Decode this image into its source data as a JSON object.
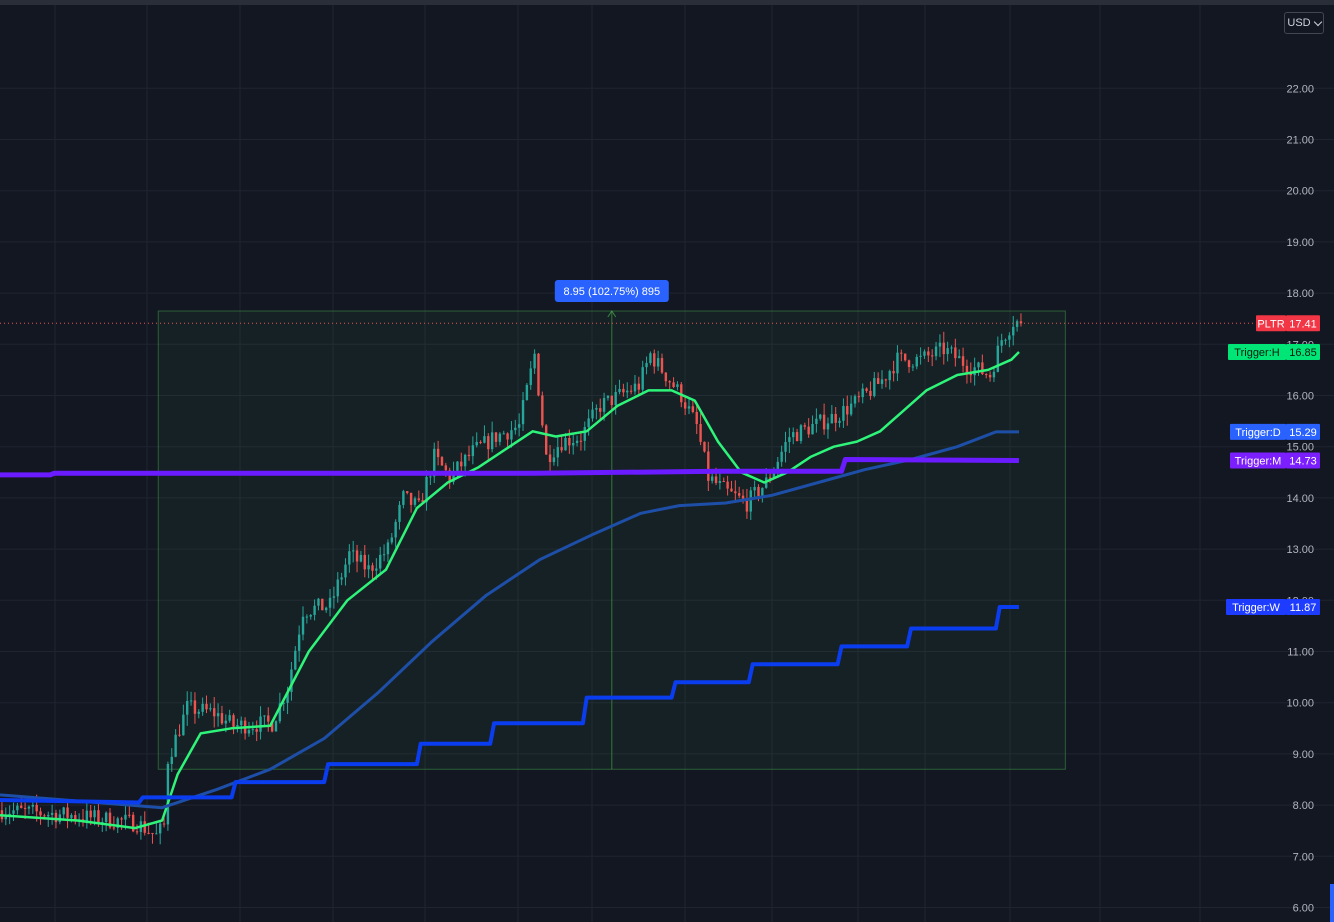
{
  "toolbar": {
    "currency": "USD"
  },
  "colors": {
    "background": "#131722",
    "grid": "#1f2430",
    "axis_text": "#b2b5be",
    "candle_up": "#26a69a",
    "candle_down": "#ef5350",
    "trigger_h": "#2ef57a",
    "trigger_d": "#1e4fa8",
    "trigger_m": "#6a1bff",
    "trigger_w": "#0b3df0",
    "measure_label": "#2962ff"
  },
  "chart_data": {
    "type": "candlestick",
    "symbol": "PLTR",
    "last_price": 17.41,
    "ylim": [
      6.0,
      23.0
    ],
    "y_ticks": [
      "6.00",
      "7.00",
      "8.00",
      "9.00",
      "10.00",
      "11.00",
      "12.00",
      "13.00",
      "14.00",
      "15.00",
      "16.00",
      "17.00",
      "18.00",
      "19.00",
      "20.00",
      "21.00",
      "22.00"
    ],
    "bar_count": 235,
    "price_path": [
      [
        0,
        7.9
      ],
      [
        18,
        7.8
      ],
      [
        35,
        7.65
      ],
      [
        40,
        7.4
      ],
      [
        42,
        7.6
      ],
      [
        43,
        8.9
      ],
      [
        48,
        9.9
      ],
      [
        55,
        9.8
      ],
      [
        60,
        9.55
      ],
      [
        70,
        9.6
      ],
      [
        74,
        10.3
      ],
      [
        78,
        11.8
      ],
      [
        85,
        11.9
      ],
      [
        90,
        12.9
      ],
      [
        95,
        12.6
      ],
      [
        100,
        13.0
      ],
      [
        104,
        14.0
      ],
      [
        108,
        13.8
      ],
      [
        112,
        14.8
      ],
      [
        116,
        14.4
      ],
      [
        122,
        14.9
      ],
      [
        128,
        15.2
      ],
      [
        134,
        15.4
      ],
      [
        138,
        16.8
      ],
      [
        141,
        14.8
      ],
      [
        145,
        15.1
      ],
      [
        150,
        15.2
      ],
      [
        155,
        15.8
      ],
      [
        160,
        16.0
      ],
      [
        165,
        16.2
      ],
      [
        168,
        16.8
      ],
      [
        172,
        16.4
      ],
      [
        176,
        16.0
      ],
      [
        180,
        15.4
      ],
      [
        183,
        14.4
      ],
      [
        188,
        14.1
      ],
      [
        193,
        13.9
      ],
      [
        198,
        14.3
      ],
      [
        204,
        15.2
      ],
      [
        210,
        15.4
      ],
      [
        216,
        15.6
      ],
      [
        222,
        15.9
      ],
      [
        228,
        16.3
      ],
      [
        232,
        16.7
      ],
      [
        238,
        16.7
      ],
      [
        244,
        16.9
      ],
      [
        250,
        16.6
      ],
      [
        256,
        16.4
      ],
      [
        259,
        17.1
      ],
      [
        262,
        17.45
      ],
      [
        264,
        17.41
      ]
    ],
    "measure": {
      "label": "8.95 (102.75%) 895",
      "from": 8.7,
      "to": 17.65,
      "bar_start": 41,
      "bar_end": 276
    },
    "series": [
      {
        "name": "Trigger:H",
        "value": 16.85,
        "label_value": "16.85",
        "points": [
          [
            0,
            7.8
          ],
          [
            20,
            7.7
          ],
          [
            35,
            7.55
          ],
          [
            42,
            7.7
          ],
          [
            46,
            8.6
          ],
          [
            52,
            9.4
          ],
          [
            60,
            9.5
          ],
          [
            70,
            9.55
          ],
          [
            80,
            11.0
          ],
          [
            90,
            12.0
          ],
          [
            100,
            12.6
          ],
          [
            108,
            13.8
          ],
          [
            116,
            14.3
          ],
          [
            124,
            14.6
          ],
          [
            132,
            15.0
          ],
          [
            138,
            15.3
          ],
          [
            144,
            15.2
          ],
          [
            152,
            15.3
          ],
          [
            160,
            15.8
          ],
          [
            168,
            16.1
          ],
          [
            174,
            16.1
          ],
          [
            180,
            15.9
          ],
          [
            186,
            15.1
          ],
          [
            192,
            14.5
          ],
          [
            198,
            14.3
          ],
          [
            204,
            14.5
          ],
          [
            210,
            14.8
          ],
          [
            216,
            15.0
          ],
          [
            222,
            15.1
          ],
          [
            228,
            15.3
          ],
          [
            234,
            15.7
          ],
          [
            240,
            16.1
          ],
          [
            248,
            16.4
          ],
          [
            256,
            16.5
          ],
          [
            262,
            16.7
          ],
          [
            264,
            16.85
          ]
        ]
      },
      {
        "name": "Trigger:D",
        "value": 15.29,
        "label_value": "15.29",
        "points": [
          [
            0,
            8.2
          ],
          [
            25,
            8.05
          ],
          [
            42,
            7.95
          ],
          [
            56,
            8.3
          ],
          [
            70,
            8.7
          ],
          [
            84,
            9.3
          ],
          [
            98,
            10.2
          ],
          [
            112,
            11.2
          ],
          [
            126,
            12.1
          ],
          [
            140,
            12.8
          ],
          [
            154,
            13.3
          ],
          [
            166,
            13.7
          ],
          [
            176,
            13.85
          ],
          [
            188,
            13.9
          ],
          [
            200,
            14.05
          ],
          [
            212,
            14.3
          ],
          [
            224,
            14.55
          ],
          [
            236,
            14.75
          ],
          [
            248,
            15.0
          ],
          [
            258,
            15.29
          ],
          [
            264,
            15.29
          ]
        ]
      },
      {
        "name": "Trigger:M",
        "value": 14.73,
        "label_value": "14.73",
        "points": [
          [
            0,
            14.45
          ],
          [
            13,
            14.45
          ],
          [
            14,
            14.48
          ],
          [
            138,
            14.48
          ],
          [
            186,
            14.52
          ],
          [
            218,
            14.52
          ],
          [
            219,
            14.75
          ],
          [
            264,
            14.73
          ]
        ]
      },
      {
        "name": "Trigger:W",
        "value": 11.87,
        "label_value": "11.87",
        "points": [
          [
            0,
            8.1
          ],
          [
            36,
            8.05
          ],
          [
            37,
            8.15
          ],
          [
            60,
            8.15
          ],
          [
            61,
            8.45
          ],
          [
            84,
            8.45
          ],
          [
            85,
            8.8
          ],
          [
            108,
            8.8
          ],
          [
            109,
            9.2
          ],
          [
            127,
            9.2
          ],
          [
            128,
            9.6
          ],
          [
            151,
            9.6
          ],
          [
            152,
            10.1
          ],
          [
            174,
            10.1
          ],
          [
            175,
            10.4
          ],
          [
            194,
            10.4
          ],
          [
            195,
            10.75
          ],
          [
            217,
            10.75
          ],
          [
            218,
            11.1
          ],
          [
            235,
            11.1
          ],
          [
            236,
            11.45
          ],
          [
            258,
            11.45
          ],
          [
            259,
            11.87
          ],
          [
            264,
            11.87
          ]
        ]
      }
    ]
  }
}
